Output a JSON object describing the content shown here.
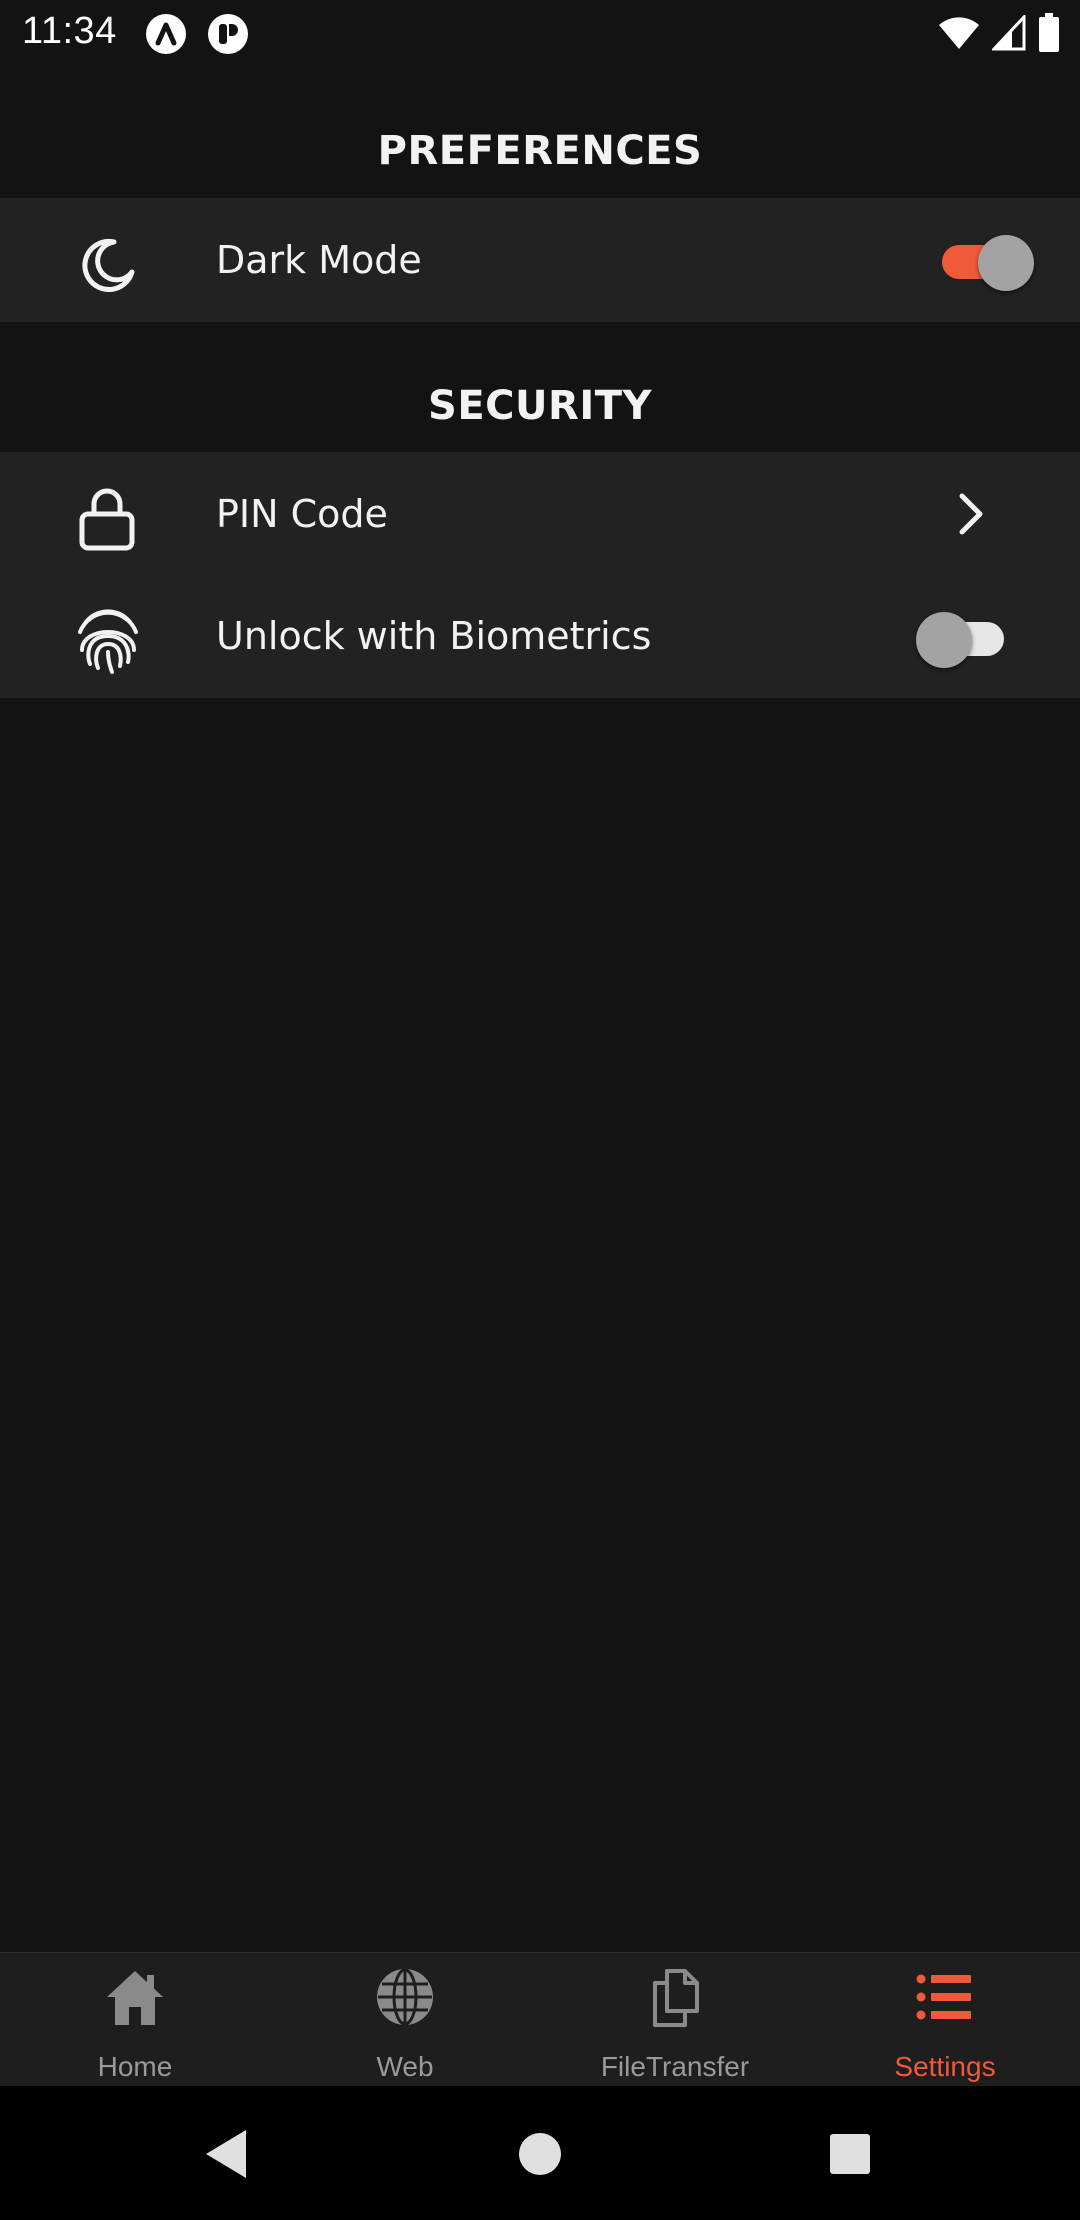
{
  "status_bar": {
    "time": "11:34"
  },
  "sections": {
    "preferences": {
      "title": "PREFERENCES",
      "items": [
        {
          "label": "Dark Mode",
          "icon": "moon-icon",
          "control": "toggle",
          "enabled": true
        }
      ]
    },
    "security": {
      "title": "SECURITY",
      "items": [
        {
          "label": "PIN Code",
          "icon": "lock-icon",
          "control": "chevron"
        },
        {
          "label": "Unlock with Biometrics",
          "icon": "fingerprint-icon",
          "control": "toggle",
          "enabled": false
        }
      ]
    }
  },
  "bottom_nav": {
    "items": [
      {
        "label": "Home",
        "icon": "home-icon",
        "active": false
      },
      {
        "label": "Web",
        "icon": "globe-icon",
        "active": false
      },
      {
        "label": "FileTransfer",
        "icon": "files-icon",
        "active": false
      },
      {
        "label": "Settings",
        "icon": "list-icon",
        "active": true
      }
    ]
  },
  "colors": {
    "accent": "#f05a3a",
    "background": "#131313",
    "card": "#222222",
    "nav_inactive": "#9a9a9a"
  }
}
